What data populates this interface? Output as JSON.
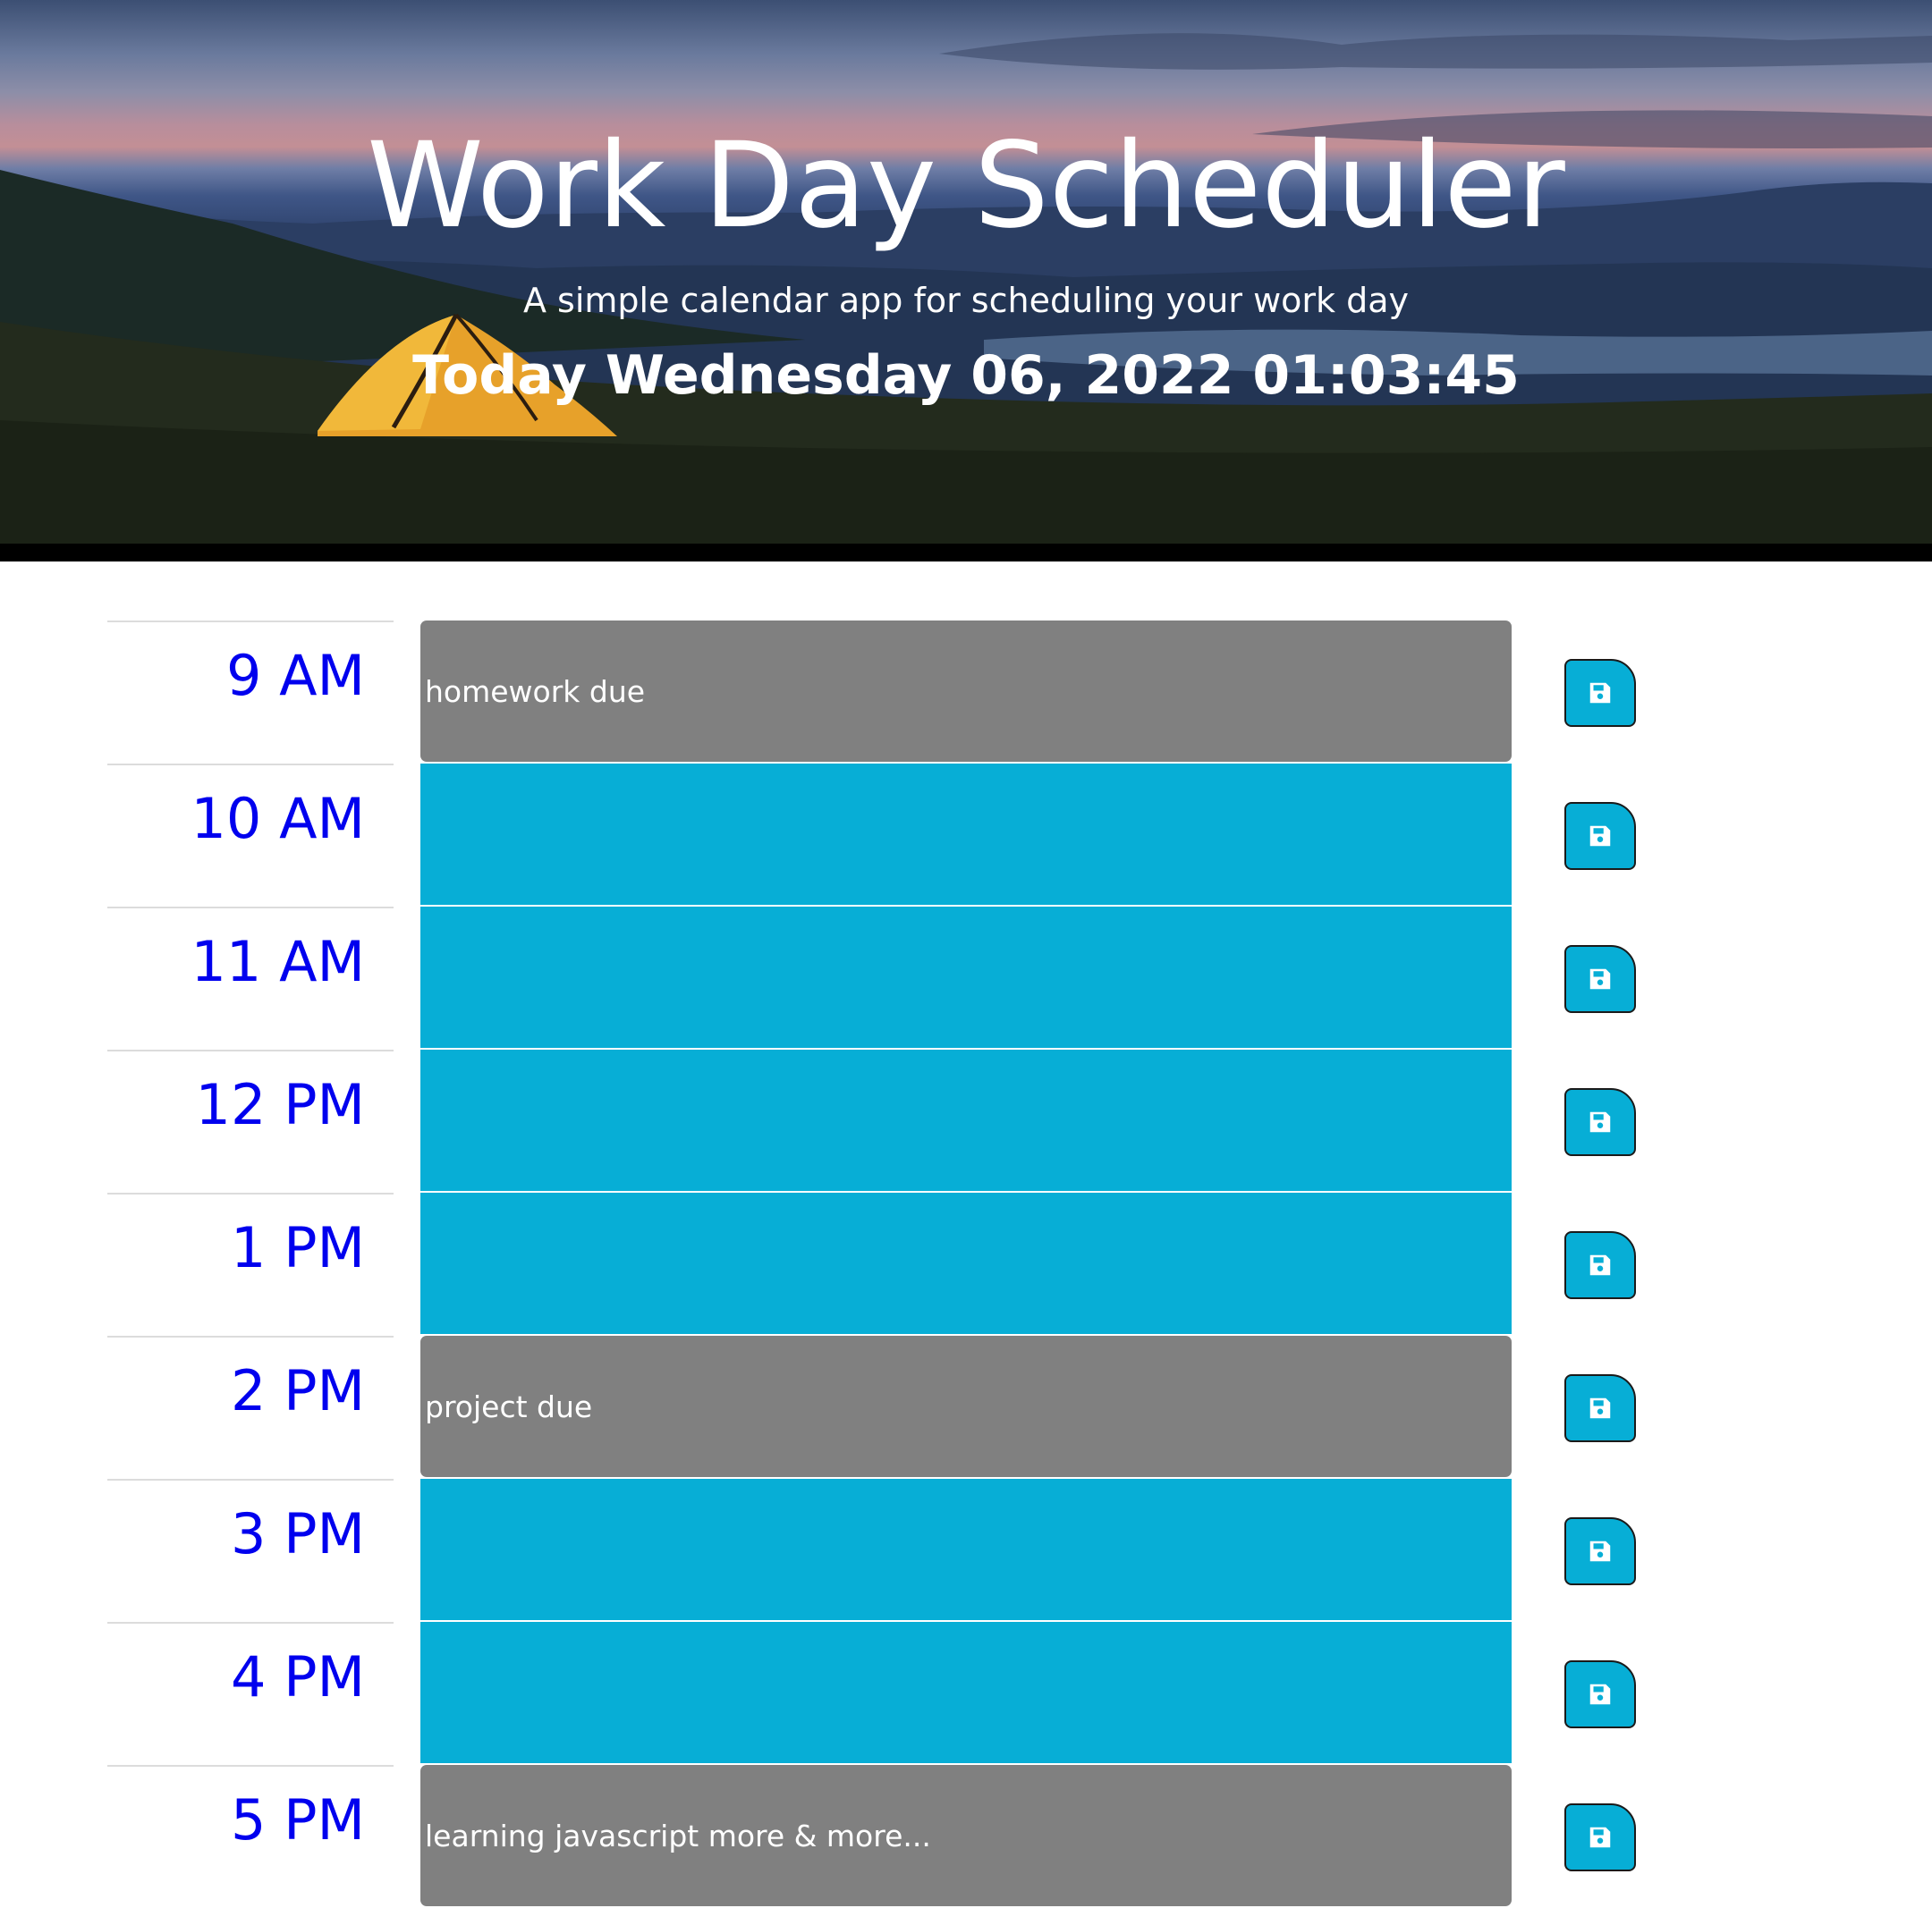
{
  "header": {
    "title": "Work Day Scheduler",
    "subtitle": "A simple calendar app for scheduling your work day",
    "current_datetime": "Today Wednesday 06, 2022 01:03:45"
  },
  "colors": {
    "past": "#808080",
    "future": "#07aed6",
    "hour_label": "#0000ee",
    "save_button": "#07aed6"
  },
  "timeblocks": [
    {
      "hour": "9 AM",
      "text": "homework due",
      "state": "past"
    },
    {
      "hour": "10 AM",
      "text": "",
      "state": "future"
    },
    {
      "hour": "11 AM",
      "text": "",
      "state": "future"
    },
    {
      "hour": "12 PM",
      "text": "",
      "state": "future"
    },
    {
      "hour": "1 PM",
      "text": "",
      "state": "future"
    },
    {
      "hour": "2 PM",
      "text": "project due",
      "state": "past"
    },
    {
      "hour": "3 PM",
      "text": "",
      "state": "future"
    },
    {
      "hour": "4 PM",
      "text": "",
      "state": "future"
    },
    {
      "hour": "5 PM",
      "text": "learning javascript more & more...",
      "state": "past"
    }
  ],
  "save_icon": "floppy-disk-icon"
}
